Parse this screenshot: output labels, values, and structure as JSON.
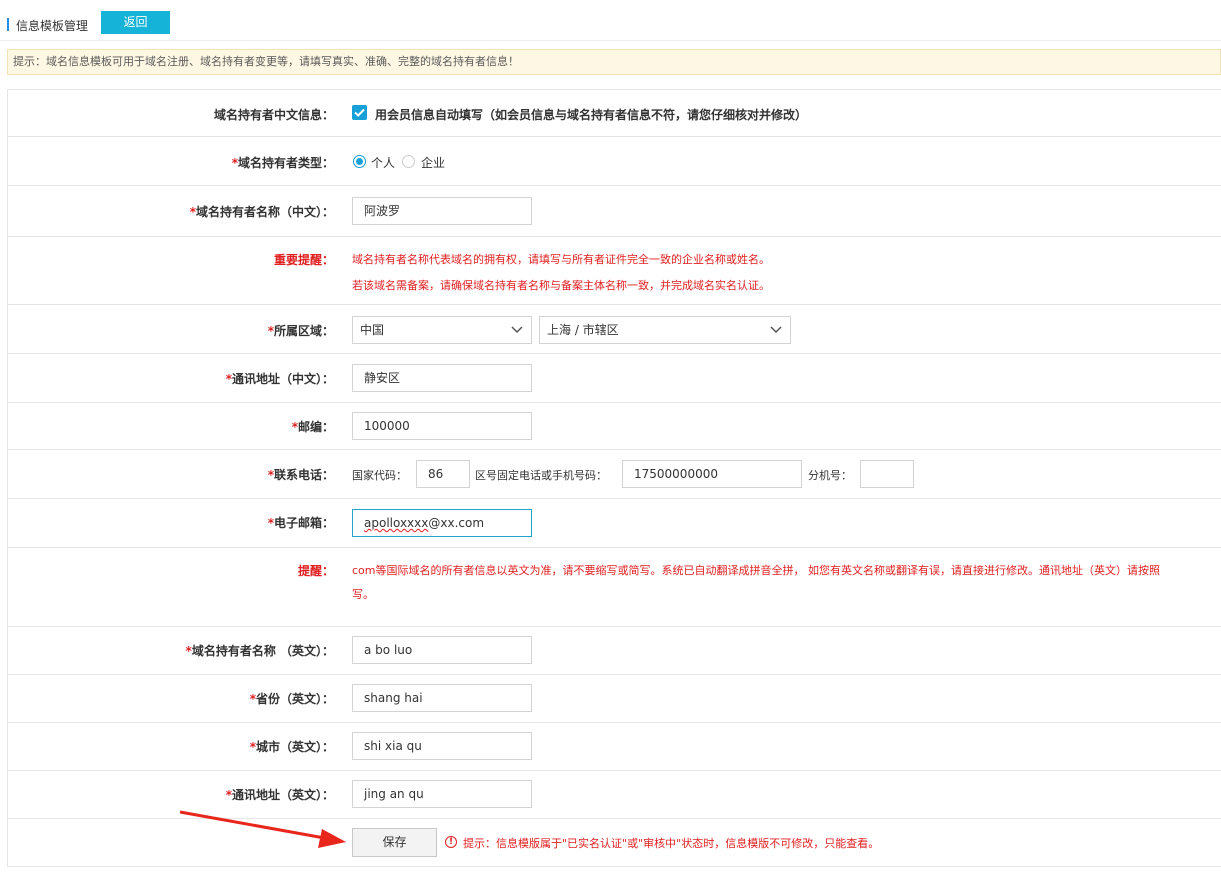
{
  "header": {
    "title": "信息模板管理",
    "back_label": "返回"
  },
  "notice": "提示：域名信息模板可用于域名注册、域名持有者变更等，请填写真实、准确、完整的域名持有者信息！",
  "fields": {
    "cn_info": {
      "label": "域名持有者中文信息：",
      "checkbox_text": "用会员信息自动填写（如会员信息与域名持有者信息不符，请您仔细核对并修改）",
      "checked": true
    },
    "owner_type": {
      "required_mark": "*",
      "label": "域名持有者类型：",
      "options": [
        "个人",
        "企业"
      ],
      "selected": "个人"
    },
    "owner_name_cn": {
      "required_mark": "*",
      "label": "域名持有者名称（中文）：",
      "value": "阿波罗"
    },
    "important": {
      "label": "重要提醒：",
      "lines": [
        "域名持有者名称代表域名的拥有权，请填写与所有者证件完全一致的企业名称或姓名。",
        "若该域名需备案，请确保域名持有者名称与备案主体名称一致，并完成域名实名认证。"
      ]
    },
    "region": {
      "required_mark": "*",
      "label": "所属区域：",
      "country": "中国",
      "city": "上海 / 市辖区"
    },
    "address_cn": {
      "required_mark": "*",
      "label": "通讯地址（中文）：",
      "value": "静安区"
    },
    "postcode": {
      "required_mark": "*",
      "label": "邮编：",
      "value": "100000"
    },
    "phone": {
      "required_mark": "*",
      "label": "联系电话：",
      "country_code_label": "国家代码：",
      "country_code": "86",
      "number_label": "区号固定电话或手机号码：",
      "number": "17500000000",
      "ext_label": "分机号：",
      "ext": ""
    },
    "email": {
      "required_mark": "*",
      "label": "电子邮箱：",
      "value_prefix": "apolloxxxx",
      "value_suffix": "@xx.com"
    },
    "reminder": {
      "label": "提醒：",
      "lines": [
        "com等国际域名的所有者信息以英文为准，请不要缩写或简写。系统已自动翻译成拼音全拼， 如您有英文名称或翻译有误，请直接进行修改。通讯地址（英文）请按照",
        "写。"
      ]
    },
    "owner_name_en": {
      "required_mark": "*",
      "label": "域名持有者名称 （英文）：",
      "value": "a bo luo"
    },
    "province_en": {
      "required_mark": "*",
      "label": "省份（英文）：",
      "value": "shang hai"
    },
    "city_en": {
      "required_mark": "*",
      "label": "城市（英文）：",
      "value": "shi xia qu"
    },
    "address_en": {
      "required_mark": "*",
      "label": "通讯地址（英文）：",
      "value": "jing an qu"
    }
  },
  "footer": {
    "save_label": "保存",
    "warn_symbol": "!",
    "warn_text": "提示：信息模版属于\"已实名认证\"或\"审核中\"状态时，信息模版不可修改，只能查看。"
  },
  "colors": {
    "accent": "#18a0d9",
    "back_button": "#15b3d7",
    "warning": "#e02020",
    "notice_bg": "#fdf7e3"
  },
  "icons": {
    "check": "checkmark-icon",
    "chevron": "chevron-down-icon",
    "warn": "warning-circle-icon",
    "annotation": "red-arrow-annotation"
  }
}
